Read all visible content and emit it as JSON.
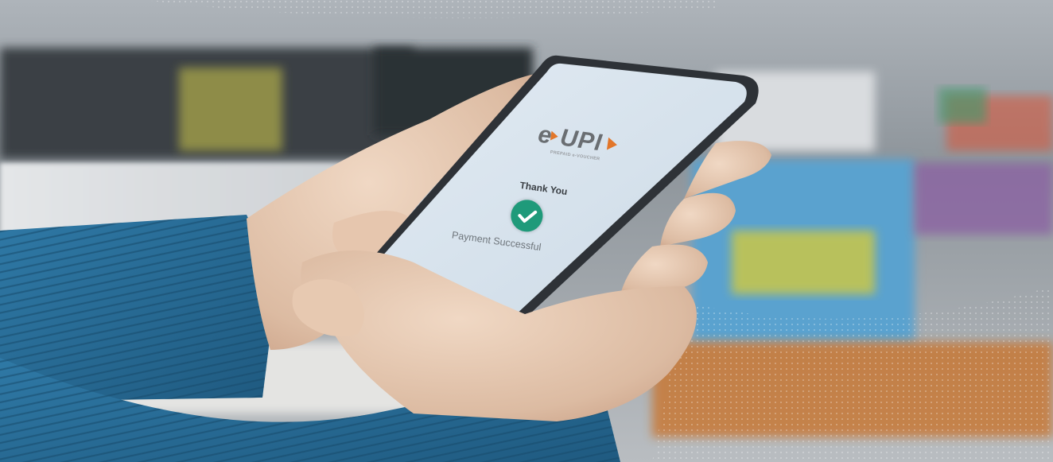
{
  "phone_screen": {
    "logo_main": "UPI",
    "logo_prefix": "e",
    "logo_tagline": "PREPAID e-VOUCHER",
    "thank_you": "Thank You",
    "status": "Payment Successful"
  },
  "colors": {
    "screen": "#d8e4ee",
    "check_badge": "#1f9a7a",
    "logo_grey": "#6a6e72",
    "logo_orange": "#e2762a",
    "sweater_blue": "#2a6c96"
  },
  "icons": {
    "check": "checkmark-icon",
    "logo": "eupi-logo"
  }
}
